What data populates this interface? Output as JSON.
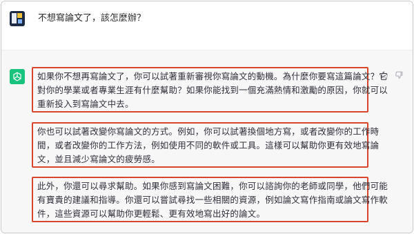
{
  "user_message": {
    "text": "不想寫論文了，該怎麼辦？"
  },
  "assistant_message": {
    "paragraphs": [
      {
        "lines": [
          "如果你不想再寫論文了，你可以試著重新審視你寫論文的動機。為什麼你要寫這篇論文？它",
          "對你的學業或者專業生涯有什麼幫助？如果你能找到一個充滿熱情和激勵的原因，你就可以",
          "重新投入到寫論文中去。"
        ]
      },
      {
        "lines": [
          "你也可以試著改變你寫論文的方式。例如，你可以試著換個地方寫，或者改變你的工作時",
          "間，或者改變你的工作方法，例如使用不同的軟件或工具。這樣可以幫助你更有效地寫論",
          "文，並且減少寫論文的疲勞感。"
        ]
      },
      {
        "lines": [
          "此外，你還可以尋求幫助。如果你感到寫論文困難，你可以諮詢你的老師或同學，他們可能",
          "有寶貴的建議和指導。你還可以嘗試尋找一些相關的資源，例如論文寫作指南或論文寫作軟",
          "件，這些資源可以幫助你更輕鬆、更有效地寫出好的論文。"
        ]
      }
    ]
  },
  "icons": {
    "user_avatar": "user-avatar-icon",
    "assistant_avatar": "chatgpt-logo-icon",
    "thumbs_up": "thumbs-up-icon",
    "thumbs_down": "thumbs-down-icon"
  },
  "colors": {
    "highlight_border": "#d8452a",
    "assistant_bg": "#f7f7f8",
    "assistant_icon_bg": "#19c37d"
  }
}
